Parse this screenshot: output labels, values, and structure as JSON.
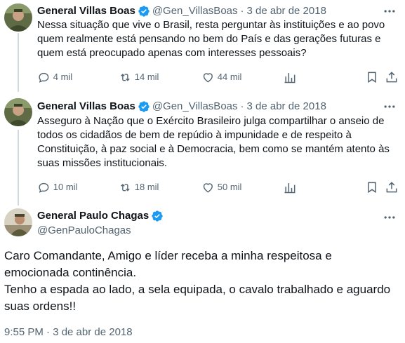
{
  "tweets": [
    {
      "name": "General Villas Boas",
      "handle": "@Gen_VillasBoas",
      "date": "3 de abr de 2018",
      "text": "Nessa situação que vive o Brasil, resta perguntar às instituições e ao povo quem realmente está pensando no bem do País e das gerações futuras e quem está preocupado apenas com interesses pessoais?",
      "replies": "4 mil",
      "retweets": "14 mil",
      "likes": "44 mil"
    },
    {
      "name": "General Villas Boas",
      "handle": "@Gen_VillasBoas",
      "date": "3 de abr de 2018",
      "text": "Asseguro à Nação que o Exército Brasileiro julga compartilhar o anseio de todos os cidadãos de bem de repúdio à impunidade e de respeito à Constituição, à paz social e à Democracia, bem como se mantém atento às suas missões institucionais.",
      "replies": "10 mil",
      "retweets": "18 mil",
      "likes": "50 mil"
    }
  ],
  "main_tweet": {
    "name": "General Paulo Chagas",
    "handle": "@GenPauloChagas",
    "text_line1": "Caro Comandante, Amigo e líder receba a minha respeitosa e emocionada continência.",
    "text_line2": "Tenho a espada ao lado, a sela equipada, o cavalo trabalhado e aguardo suas ordens!!",
    "timestamp": "9:55 PM · 3 de abr de 2018"
  },
  "colors": {
    "verified": "#1d9bf0",
    "secondary_text": "#536471",
    "thread_line": "#cfd9de"
  },
  "icons": [
    "reply-icon",
    "retweet-icon",
    "like-icon",
    "analytics-icon",
    "bookmark-icon",
    "more-icon",
    "verified-badge-icon"
  ]
}
